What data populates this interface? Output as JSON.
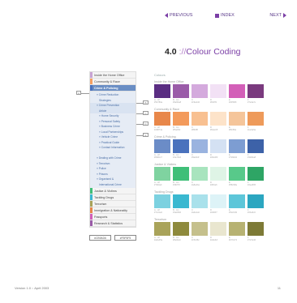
{
  "nav": {
    "prev": "PREVIOUS",
    "index": "INDEX",
    "next": "NEXT"
  },
  "title": {
    "number": "4.0",
    "prefix": "://",
    "text": "Colour Coding"
  },
  "colours_heading": "Colours",
  "groups": [
    {
      "label": "Inside the Home Office",
      "swatches": [
        {
          "color": "#52780a",
          "fill": "#5a2d82",
          "pct": "A - off",
          "hex": "#52780a"
        },
        {
          "color": "#9a5ba8",
          "fill": "#9a5ba8",
          "pct": "B - tint",
          "hex": "#9a5ba8"
        },
        {
          "color": "#c9a4d4",
          "fill": "#d4aadd",
          "pct": "C",
          "hex": "#c9a4d4"
        },
        {
          "color": "#f0dff3",
          "fill": "#f2e1f5",
          "pct": "D",
          "hex": "#f0dff3"
        },
        {
          "color": "#d35fb8",
          "fill": "#d35fb8",
          "pct": "E",
          "hex": "#d35fb8"
        },
        {
          "color": "#7a3a7e",
          "fill": "#7a3a7e",
          "pct": "F",
          "hex": "#7a3a7e"
        }
      ]
    },
    {
      "label": "Community & Race",
      "swatches": [
        {
          "color": "#e8874a",
          "fill": "#e8874a",
          "pct": "A - off",
          "hex": "#e8874a"
        },
        {
          "color": "#f5a062",
          "fill": "#f39a5b",
          "pct": "B - tint",
          "hex": "#f5a062"
        },
        {
          "color": "#f8bf8f",
          "fill": "#f8c091",
          "pct": "C",
          "hex": "#f8bf8f"
        },
        {
          "color": "#fde2c8",
          "fill": "#fde3c9",
          "pct": "D",
          "hex": "#fde2c8"
        },
        {
          "color": "#f8c89e",
          "fill": "#f5c59a",
          "pct": "E",
          "hex": "#f8c89e"
        },
        {
          "color": "#ee9a5a",
          "fill": "#ee9a5a",
          "pct": "F",
          "hex": "#ee9a5a"
        }
      ]
    },
    {
      "label": "Crime & Policing",
      "swatches": [
        {
          "color": "#6b8cc7",
          "fill": "#6b8cc7",
          "pct": "A - off",
          "hex": "#6b8cc7"
        },
        {
          "color": "#4a72bd",
          "fill": "#4a72bd",
          "pct": "B - tint",
          "hex": "#4a72bd"
        },
        {
          "color": "#9ab3df",
          "fill": "#9ab3df",
          "pct": "C",
          "hex": "#9ab3df"
        },
        {
          "color": "#d3e0f3",
          "fill": "#d4e1f3",
          "pct": "D",
          "hex": "#d3e0f3"
        },
        {
          "color": "#7d9dd2",
          "fill": "#7d9dd2",
          "pct": "E",
          "hex": "#7d9dd2"
        },
        {
          "color": "#3d62a8",
          "fill": "#3d62a8",
          "pct": "F",
          "hex": "#3d62a8"
        }
      ]
    },
    {
      "label": "Justice & Victims",
      "swatches": [
        {
          "color": "#7fd3a0",
          "fill": "#7fd3a0",
          "pct": "A - off",
          "hex": "#7fd3a0"
        },
        {
          "color": "#3fbf78",
          "fill": "#3fbf78",
          "pct": "B - tint",
          "hex": "#3fbf78"
        },
        {
          "color": "#a8e4be",
          "fill": "#a8e4be",
          "pct": "C",
          "hex": "#a8e4be"
        },
        {
          "color": "#dff4e6",
          "fill": "#dff4e6",
          "pct": "D",
          "hex": "#dff4e6"
        },
        {
          "color": "#58c98a",
          "fill": "#58c98a",
          "pct": "E",
          "hex": "#58c98a"
        },
        {
          "color": "#2ea565",
          "fill": "#2ea565",
          "pct": "F",
          "hex": "#2ea565"
        }
      ]
    },
    {
      "label": "Tackling Drugs",
      "swatches": [
        {
          "color": "#7cd1e0",
          "fill": "#7cd1e0",
          "pct": "A - off",
          "hex": "#7cd1e0"
        },
        {
          "color": "#3ab8d0",
          "fill": "#3ab8d0",
          "pct": "B - tint",
          "hex": "#3ab8d0"
        },
        {
          "color": "#a9e1eb",
          "fill": "#a9e1eb",
          "pct": "C",
          "hex": "#a9e1eb"
        },
        {
          "color": "#ddf3f7",
          "fill": "#ddf3f7",
          "pct": "D",
          "hex": "#ddf3f7"
        },
        {
          "color": "#5dc6d9",
          "fill": "#5dc6d9",
          "pct": "E",
          "hex": "#5dc6d9"
        },
        {
          "color": "#2ba6c0",
          "fill": "#2ba6c0",
          "pct": "F",
          "hex": "#2ba6c0"
        }
      ]
    },
    {
      "label": "Terrorism",
      "swatches": [
        {
          "color": "#a9a35a",
          "fill": "#a9a35a",
          "pct": "A - off",
          "hex": "#a9a35a"
        },
        {
          "color": "#8e8a3c",
          "fill": "#8e8a3c",
          "pct": "B - tint",
          "hex": "#8e8a3c"
        },
        {
          "color": "#c5c08c",
          "fill": "#c5c08c",
          "pct": "C",
          "hex": "#c5c08c"
        },
        {
          "color": "#e9e6cf",
          "fill": "#e9e6cf",
          "pct": "D",
          "hex": "#e9e6cf"
        },
        {
          "color": "#b7b272",
          "fill": "#b7b272",
          "pct": "E",
          "hex": "#b7b272"
        },
        {
          "color": "#7d7a36",
          "fill": "#7d7a36",
          "pct": "F",
          "hex": "#7d7a36"
        }
      ]
    }
  ],
  "sidebar": {
    "items_top": [
      {
        "label": "Inside the Home Office",
        "bar": "#c9a4d4"
      },
      {
        "label": "Community & Race",
        "bar": "#f5a062"
      },
      {
        "label": "Crime & Policing",
        "bar": "#4a72bd",
        "active": true
      }
    ],
    "sub_items": [
      {
        "label": "» Crime Reduction",
        "indent": false
      },
      {
        "label": "Strategies",
        "indent": true
      },
      {
        "label": "» Crime Prevention",
        "indent": false,
        "highlight": true
      },
      {
        "label": "Article",
        "indent": true,
        "highlight": true
      },
      {
        "label": "» Home Security",
        "indent": true
      },
      {
        "label": "» Personal Safety",
        "indent": true
      },
      {
        "label": "» Business Crime",
        "indent": true
      },
      {
        "label": "» Local Partnerships",
        "indent": true
      },
      {
        "label": "» Vehicle Crime",
        "indent": true
      },
      {
        "label": "» Practical Guide",
        "indent": true
      },
      {
        "label": "» Contact Information",
        "indent": true
      },
      {
        "label": "",
        "indent": false
      },
      {
        "label": "» Dealing with Crime",
        "indent": false
      },
      {
        "label": "» Terrorism",
        "indent": false
      },
      {
        "label": "» Police",
        "indent": false
      },
      {
        "label": "» Prisons",
        "indent": false
      },
      {
        "label": "» Organised &",
        "indent": false
      },
      {
        "label": "International Crime",
        "indent": true
      }
    ],
    "items_bottom": [
      {
        "label": "Justice & Victims",
        "bar": "#3fbf78"
      },
      {
        "label": "Tackling Drugs",
        "bar": "#3ab8d0"
      },
      {
        "label": "Terrorism",
        "bar": "#a9a35a"
      },
      {
        "label": "Immigration & Nationality",
        "bar": "#e8874a"
      },
      {
        "label": "Passports",
        "bar": "#d35fb8"
      },
      {
        "label": "Research & Statistics",
        "bar": "#9a5ba8"
      }
    ]
  },
  "markers": [
    "A",
    "B",
    "C",
    "D",
    "E"
  ],
  "hex_boxes": [
    "#CB9AD6",
    "#F5F5F5"
  ],
  "footer": {
    "left": "Version 1.0 :: April 2003",
    "right": "11"
  }
}
